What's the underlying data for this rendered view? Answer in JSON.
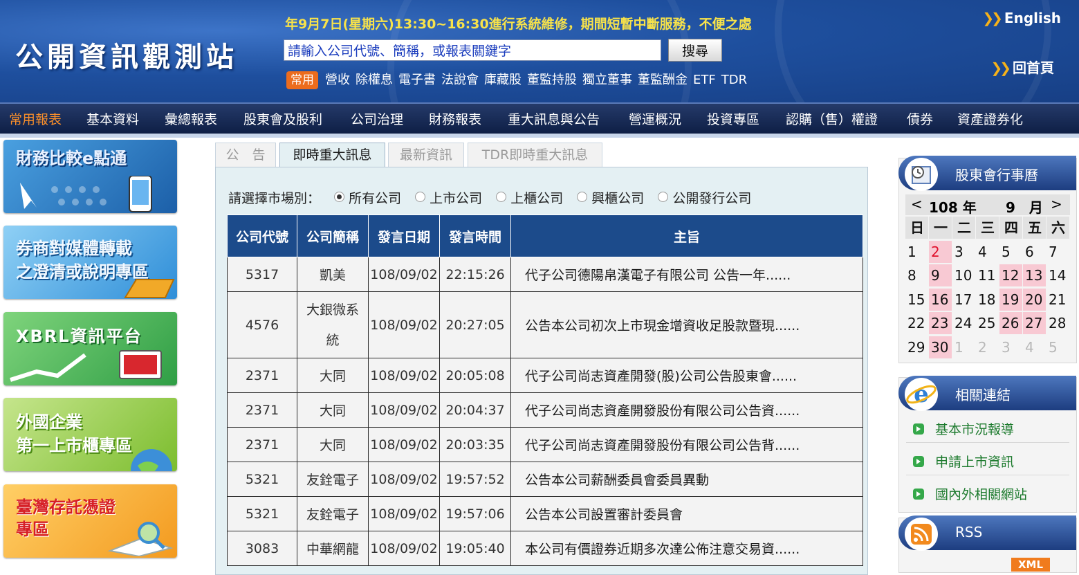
{
  "header": {
    "logo": "公開資訊觀測站",
    "notice": "年9月7日(星期六)13:30~16:30進行系統維修，期間短暫中斷服務，不便之處",
    "search_placeholder": "請輸入公司代號、簡稱，或報表關鍵字",
    "search_button": "搜尋",
    "common_badge": "常用",
    "quick_links": [
      "營收",
      "除權息",
      "電子書",
      "法說會",
      "庫藏股",
      "董監持股",
      "獨立董事",
      "董監酬金",
      "ETF",
      "TDR"
    ],
    "english_link": "English",
    "home_link": "回首頁"
  },
  "nav": [
    "常用報表",
    "基本資料",
    "彙總報表",
    "股東會及股利",
    "公司治理",
    "財務報表",
    "重大訊息與公告",
    "營運概況",
    "投資專區",
    "認購（售）權證",
    "債券",
    "資產證券化"
  ],
  "banners": {
    "b1": "財務比較e點通",
    "b2a": "券商對媒體轉載",
    "b2b": "之澄清或說明專區",
    "b3": "XBRL資訊平台",
    "b4a": "外國企業",
    "b4b": "第一上市櫃專區",
    "b5a": "臺灣存託憑證",
    "b5b": "專區"
  },
  "tabs": [
    "公　告",
    "即時重大訊息",
    "最新資訊",
    "TDR即時重大訊息"
  ],
  "market": {
    "label": "請選擇市場別：",
    "options": [
      "所有公司",
      "上市公司",
      "上櫃公司",
      "興櫃公司",
      "公開發行公司"
    ],
    "selected": "所有公司"
  },
  "table": {
    "headers": [
      "公司代號",
      "公司簡稱",
      "發言日期",
      "發言時間",
      "主旨"
    ],
    "rows": [
      [
        "5317",
        "凱美",
        "108/09/02",
        "22:15:26",
        "代子公司德陽帛漢電子有限公司 公告一年......"
      ],
      [
        "4576",
        "大銀微系統",
        "108/09/02",
        "20:27:05",
        "公告本公司初次上市現金增資收足股款暨現......"
      ],
      [
        "2371",
        "大同",
        "108/09/02",
        "20:05:08",
        "代子公司尚志資產開發(股)公司公告股東會......"
      ],
      [
        "2371",
        "大同",
        "108/09/02",
        "20:04:37",
        "代子公司尚志資產開發股份有限公司公告資......"
      ],
      [
        "2371",
        "大同",
        "108/09/02",
        "20:03:35",
        "代子公司尚志資產開發股份有限公司公告背......"
      ],
      [
        "5321",
        "友銓電子",
        "108/09/02",
        "19:57:52",
        "公告本公司薪酬委員會委員異動"
      ],
      [
        "5321",
        "友銓電子",
        "108/09/02",
        "19:57:06",
        "公告本公司設置審計委員會"
      ],
      [
        "3083",
        "中華網龍",
        "108/09/02",
        "19:05:40",
        "本公司有價證券近期多次達公佈注意交易資......"
      ]
    ]
  },
  "calendar": {
    "title": "股東會行事曆",
    "year": "108 年",
    "month": "9　月",
    "prev": "<",
    "next": ">",
    "weekdays": [
      "日",
      "一",
      "二",
      "三",
      "四",
      "五",
      "六"
    ],
    "weeks": [
      [
        "1",
        "2",
        "3",
        "4",
        "5",
        "6",
        "7"
      ],
      [
        "8",
        "9",
        "10",
        "11",
        "12",
        "13",
        "14"
      ],
      [
        "15",
        "16",
        "17",
        "18",
        "19",
        "20",
        "21"
      ],
      [
        "22",
        "23",
        "24",
        "25",
        "26",
        "27",
        "28"
      ],
      [
        "29",
        "30",
        "1",
        "2",
        "3",
        "4",
        "5"
      ]
    ],
    "highlight_color": "#f8c9d3",
    "holiday_text_color": "#e0102c"
  },
  "related": {
    "title": "相關連結",
    "items": [
      "基本市況報導",
      "申請上市資訊",
      "國內外相關網站"
    ]
  },
  "rss": {
    "title": "RSS",
    "badge": "XML"
  },
  "colors": {
    "header_blue": "#1e4f9e",
    "nav_active": "#f78e2b",
    "table_header": "#1c4b8b",
    "notice_yellow": "#f7e24a"
  }
}
